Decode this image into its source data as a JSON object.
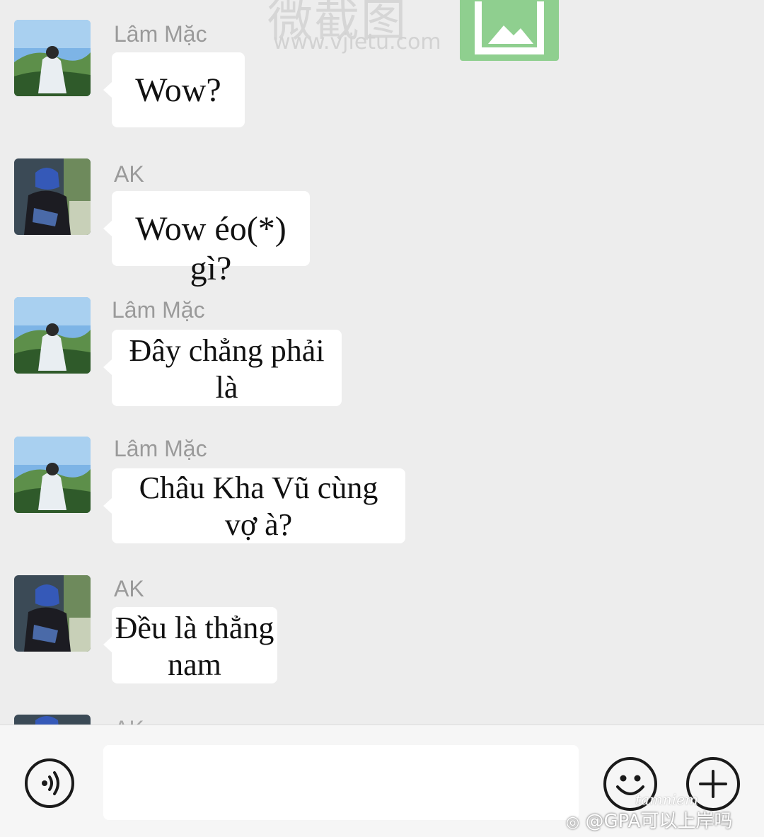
{
  "watermark": {
    "brand": "微截图",
    "url": "www.vjietu.com"
  },
  "messages": [
    {
      "sender": "Lâm Mặc",
      "avatar": "landscape-avatar-icon",
      "lines": [
        "Wow?"
      ]
    },
    {
      "sender": "AK",
      "avatar": "hooded-person-avatar-icon",
      "lines": [
        "Wow éo(*) gì?"
      ]
    },
    {
      "sender": "Lâm Mặc",
      "avatar": "landscape-avatar-icon",
      "lines": [
        "Đây chẳng phải",
        "là"
      ]
    },
    {
      "sender": "Lâm Mặc",
      "avatar": "landscape-avatar-icon",
      "lines": [
        "Châu Kha Vũ cùng",
        "vợ à?"
      ]
    },
    {
      "sender": "AK",
      "avatar": "hooded-person-avatar-icon",
      "lines": [
        "Đều là thẳng",
        "nam"
      ]
    },
    {
      "sender": "AK",
      "avatar": "hooded-person-avatar-icon",
      "lines": []
    }
  ],
  "input_bar": {
    "voice_icon": "voice-icon",
    "emoji_icon": "emoji-icon",
    "plus_icon": "plus-icon",
    "text_value": ""
  },
  "credit": {
    "signature": "tamniem",
    "handle": "@GPA可以上岸吗"
  },
  "colors": {
    "background": "#ededed",
    "bubble": "#ffffff",
    "sender": "#9a9a9a"
  }
}
